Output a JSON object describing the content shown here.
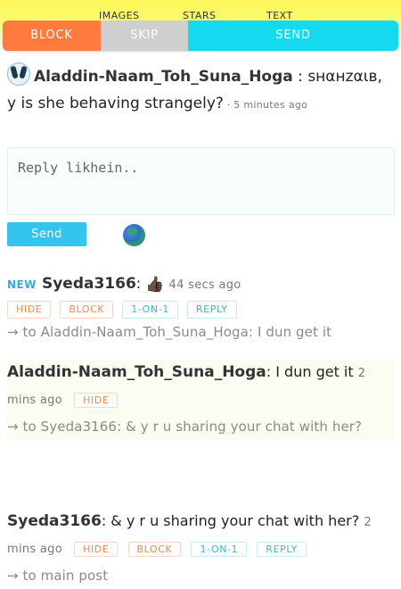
{
  "tabs": [
    "IMAGES",
    "STARS",
    "TEXT"
  ],
  "toolbar": {
    "block": "BLOCK",
    "skip": "SKIP",
    "send": "SEND"
  },
  "post": {
    "username": "Aladdin-Naam_Toh_Suna_Hoga",
    "sep": " : ",
    "handle": "ѕнαнzαιв",
    "text": ", y is she behaving strangely?",
    "dash": " · ",
    "time": "5 minutes ago"
  },
  "reply_box": {
    "placeholder": "Reply likhein.."
  },
  "send_label": "Send",
  "replies": [
    {
      "new": "NEW",
      "username": "Syeda3166",
      "text": ":",
      "emoji": "👍🏿",
      "time": "44 secs ago",
      "actions": [
        "HIDE",
        "BLOCK",
        "1-ON-1",
        "REPLY"
      ],
      "to": "→ to Aladdin-Naam_Toh_Suna_Hoga: I dun get it"
    },
    {
      "username": "Aladdin-Naam_Toh_Suna_Hoga",
      "text": ": I dun get it",
      "time": "2 mins ago",
      "actions": [
        "HIDE"
      ],
      "to": "→ to Syeda3166: & y r u sharing your chat with her?"
    },
    {
      "username": "Syeda3166",
      "text": ": & y r u sharing your chat with her?",
      "time": "2 mins ago",
      "actions": [
        "HIDE",
        "BLOCK",
        "1-ON-1",
        "REPLY"
      ],
      "to": "→ to main post"
    }
  ]
}
